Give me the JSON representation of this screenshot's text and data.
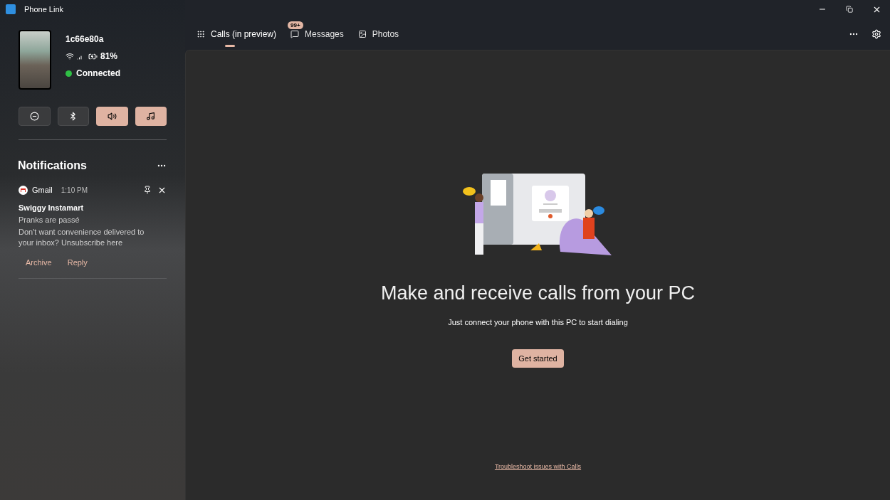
{
  "window": {
    "title": "Phone Link"
  },
  "device": {
    "name": "1c66e80a",
    "battery": "81%",
    "status": "Connected",
    "connected": true
  },
  "quick_actions": [
    {
      "kind": "do-not-disturb",
      "on": false
    },
    {
      "kind": "bluetooth",
      "on": false
    },
    {
      "kind": "volume",
      "on": true
    },
    {
      "kind": "music",
      "on": true
    }
  ],
  "notifications": {
    "title": "Notifications",
    "items": [
      {
        "app": "Gmail",
        "time": "1:10 PM",
        "sender": "Swiggy Instamart",
        "subject": "Pranks are passé",
        "body": "Don't want convenience delivered to your inbox? Unsubscribe here",
        "actions": [
          "Archive",
          "Reply"
        ]
      }
    ]
  },
  "tabs": [
    {
      "kind": "calls",
      "label": "Calls (in preview)",
      "selected": true
    },
    {
      "kind": "messages",
      "label": "Messages",
      "selected": false,
      "badge": "99+"
    },
    {
      "kind": "photos",
      "label": "Photos",
      "selected": false
    }
  ],
  "main": {
    "heading": "Make and receive calls from your PC",
    "subtitle": "Just connect your phone with this PC to start dialing",
    "button": "Get started",
    "link": "Troubleshoot issues with Calls"
  }
}
